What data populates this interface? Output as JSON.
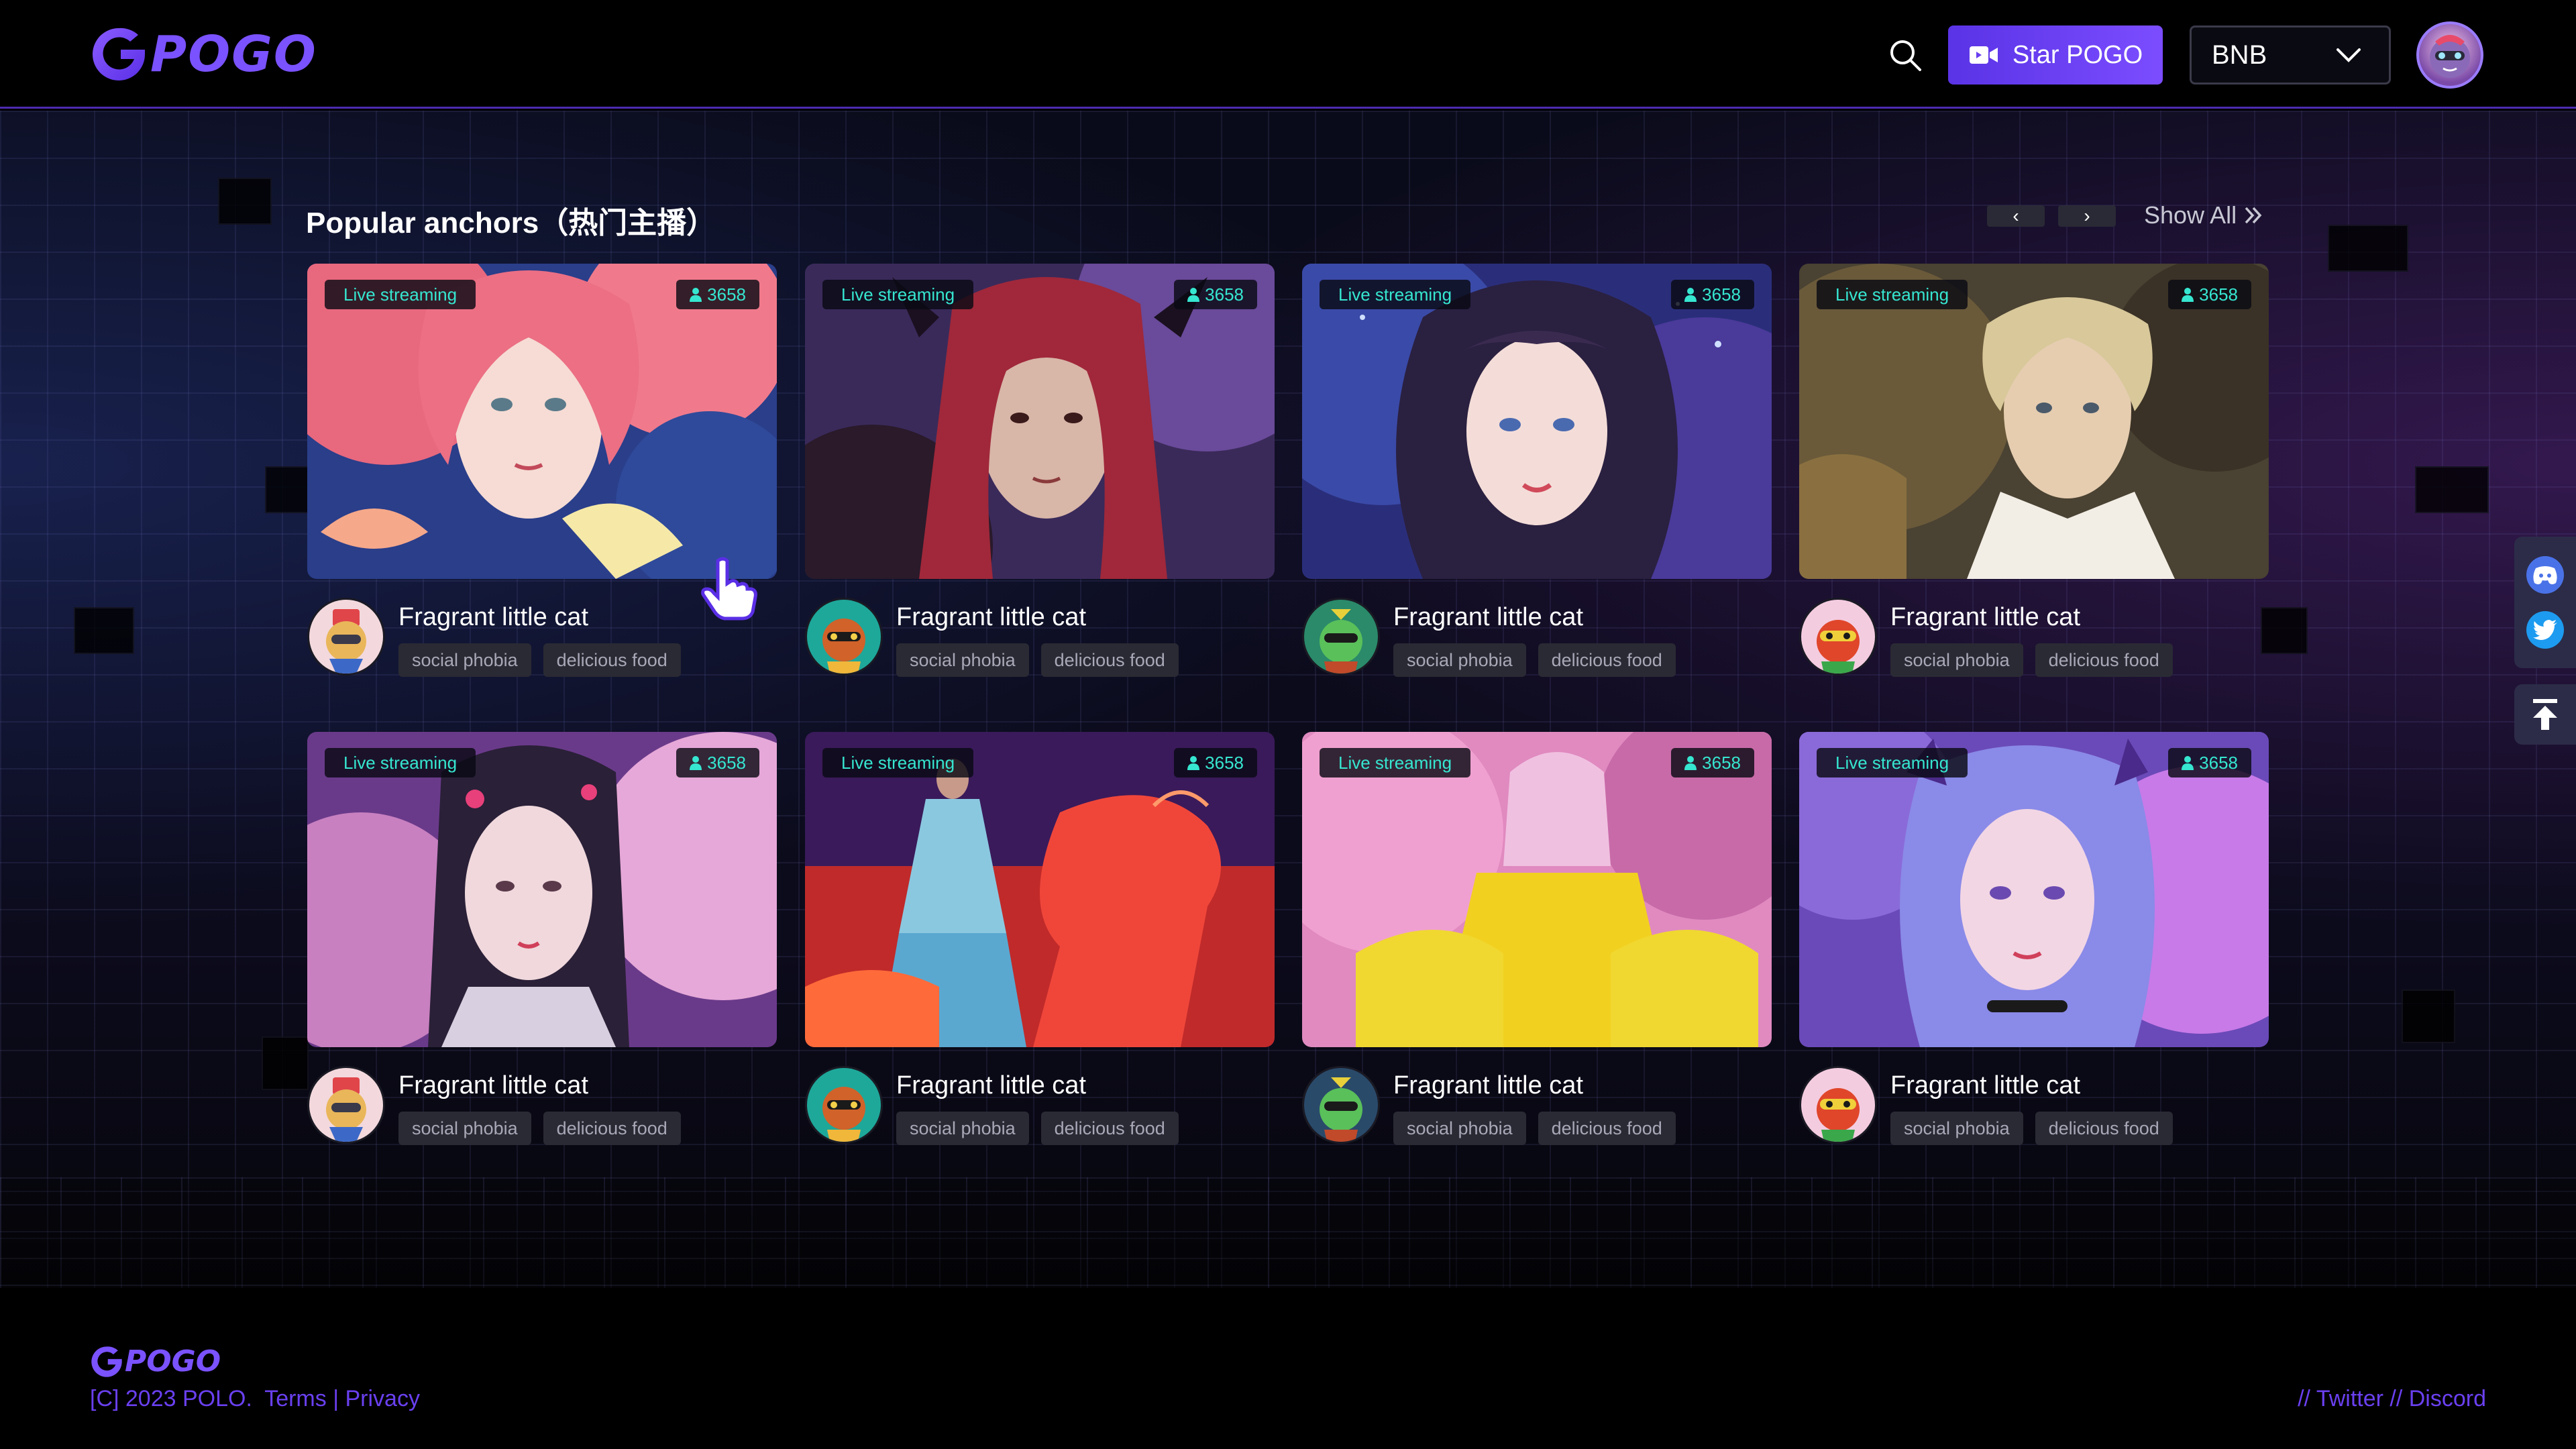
{
  "brand": {
    "logo_text": "POGO",
    "accent": "#7a52ff"
  },
  "header": {
    "search_icon": "search-icon",
    "star_button_label": "Star POGO",
    "network_select": {
      "selected": "BNB"
    }
  },
  "section": {
    "title": "Popular anchors（热门主播）",
    "prev_label": "‹",
    "next_label": "›",
    "show_all_label": "Show All"
  },
  "cards": [
    {
      "status": "Live streaming",
      "viewers": "3658",
      "name": "Fragrant little cat",
      "tags": [
        "social phobia",
        "delicious food"
      ]
    },
    {
      "status": "Live streaming",
      "viewers": "3658",
      "name": "Fragrant little cat",
      "tags": [
        "social phobia",
        "delicious food"
      ]
    },
    {
      "status": "Live streaming",
      "viewers": "3658",
      "name": "Fragrant little cat",
      "tags": [
        "social phobia",
        "delicious food"
      ]
    },
    {
      "status": "Live streaming",
      "viewers": "3658",
      "name": "Fragrant little cat",
      "tags": [
        "social phobia",
        "delicious food"
      ]
    },
    {
      "status": "Live streaming",
      "viewers": "3658",
      "name": "Fragrant little cat",
      "tags": [
        "social phobia",
        "delicious food"
      ]
    },
    {
      "status": "Live streaming",
      "viewers": "3658",
      "name": "Fragrant little cat",
      "tags": [
        "social phobia",
        "delicious food"
      ]
    },
    {
      "status": "Live streaming",
      "viewers": "3658",
      "name": "Fragrant little cat",
      "tags": [
        "social phobia",
        "delicious food"
      ]
    },
    {
      "status": "Live streaming",
      "viewers": "3658",
      "name": "Fragrant little cat",
      "tags": [
        "social phobia",
        "delicious food"
      ]
    }
  ],
  "side_rail": {
    "icons": [
      "discord-icon",
      "twitter-icon",
      "back-to-top-icon"
    ]
  },
  "footer": {
    "logo_text": "POGO",
    "copyright": "[C] 2023 POLO.",
    "terms_label": "Terms",
    "separator": "|",
    "privacy_label": "Privacy",
    "twitter_label": "// Twitter",
    "discord_label": "// Discord"
  }
}
